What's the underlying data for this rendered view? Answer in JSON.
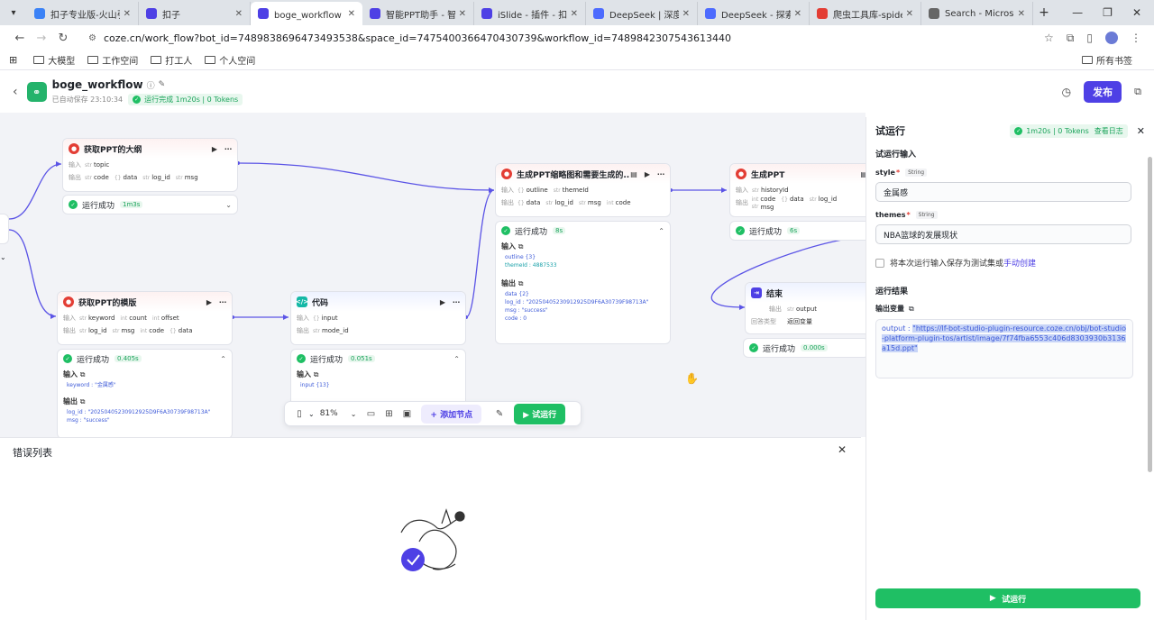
{
  "browser": {
    "tabs": [
      {
        "title": "扣子专业版-火山引擎",
        "color": "#3b82f6",
        "active": false
      },
      {
        "title": "扣子",
        "color": "#4e40e5",
        "active": false
      },
      {
        "title": "boge_workflow - 工",
        "color": "#4e40e5",
        "active": true
      },
      {
        "title": "智能PPT助手 - 智能",
        "color": "#4e40e5",
        "active": false
      },
      {
        "title": "iSlide - 插件 - 扣子",
        "color": "#4e40e5",
        "active": false
      },
      {
        "title": "DeepSeek | 深度求索",
        "color": "#4d6bfe",
        "active": false
      },
      {
        "title": "DeepSeek - 探索未至",
        "color": "#4d6bfe",
        "active": false
      },
      {
        "title": "爬虫工具库-spidert",
        "color": "#e33d34",
        "active": false
      },
      {
        "title": "Search - Microsoft",
        "color": "#666666",
        "active": false
      }
    ],
    "url": "coze.cn/work_flow?bot_id=7489838696473493538&space_id=7475400366470430739&workflow_id=7489842307543613440",
    "bookmarks": [
      "大模型",
      "工作空间",
      "打工人",
      "个人空间"
    ],
    "all_bookmarks": "所有书签"
  },
  "header": {
    "title": "boge_workflow",
    "autosave": "已自动保存 23:10:34",
    "run_status": "运行完成 1m20s | 0 Tokens",
    "publish": "发布"
  },
  "nodes": {
    "outline": {
      "title": "获取PPT的大纲",
      "input_label": "输入",
      "inputs": [
        {
          "type": "str",
          "name": "topic"
        }
      ],
      "output_label": "输出",
      "outputs": [
        {
          "type": "str",
          "name": "code"
        },
        {
          "type": "{}",
          "name": "data"
        },
        {
          "type": "str",
          "name": "log_id"
        },
        {
          "type": "str",
          "name": "msg"
        }
      ],
      "run": "运行成功",
      "time": "1m3s"
    },
    "template": {
      "title": "获取PPT的模版",
      "input_label": "输入",
      "inputs": [
        {
          "type": "str",
          "name": "keyword"
        },
        {
          "type": "int",
          "name": "count"
        },
        {
          "type": "int",
          "name": "offset"
        }
      ],
      "output_label": "输出",
      "outputs": [
        {
          "type": "str",
          "name": "log_id"
        },
        {
          "type": "str",
          "name": "msg"
        },
        {
          "type": "int",
          "name": "code"
        },
        {
          "type": "{}",
          "name": "data"
        }
      ],
      "run": "运行成功",
      "time": "0.405s",
      "in_sec": "输入",
      "in_lines": [
        "keyword : \"金属感\""
      ],
      "out_sec": "输出",
      "out_lines": [
        "log_id : \"20250405230912925D9F6A30739F98713A\"",
        "msg : \"success\""
      ]
    },
    "code": {
      "title": "代码",
      "input_label": "输入",
      "inputs": [
        {
          "type": "{}",
          "name": "input"
        }
      ],
      "output_label": "输出",
      "outputs": [
        {
          "type": "str",
          "name": "mode_id"
        }
      ],
      "run": "运行成功",
      "time": "0.051s",
      "in_sec": "输入",
      "in_lines": [
        "input {13}"
      ]
    },
    "thumb": {
      "title": "生成PPT缩略图和需要生成的...",
      "input_label": "输入",
      "inputs": [
        {
          "type": "{}",
          "name": "outline"
        },
        {
          "type": "str",
          "name": "themeId"
        }
      ],
      "output_label": "输出",
      "outputs": [
        {
          "type": "{}",
          "name": "data"
        },
        {
          "type": "str",
          "name": "log_id"
        },
        {
          "type": "str",
          "name": "msg"
        },
        {
          "type": "int",
          "name": "code"
        }
      ],
      "run": "运行成功",
      "time": "8s",
      "in_sec": "输入",
      "in_lines": [
        "outline {3}",
        "themeId : 4887533"
      ],
      "out_sec": "输出",
      "out_lines": [
        "data {2}",
        "log_id : \"20250405230912925D9F6A30739F98713A\"",
        "msg : \"success\"",
        "code : 0"
      ]
    },
    "gen": {
      "title": "生成PPT",
      "input_label": "输入",
      "inputs": [
        {
          "type": "str",
          "name": "historyId"
        }
      ],
      "output_label": "输出",
      "outputs": [
        {
          "type": "int",
          "name": "code"
        },
        {
          "type": "{}",
          "name": "data"
        },
        {
          "type": "str",
          "name": "log_id"
        },
        {
          "type": "str",
          "name": "msg"
        }
      ],
      "run": "运行成功",
      "time": "6s"
    },
    "end": {
      "title": "结束",
      "output_label": "输出",
      "outputs": [
        {
          "type": "str",
          "name": "output"
        }
      ],
      "mode_label": "回答类型",
      "mode_value": "返回变量",
      "run": "运行成功",
      "time": "0.000s"
    }
  },
  "toolbar": {
    "zoom": "81%",
    "add_node": "+ 添加节点",
    "test_run": "试运行"
  },
  "error_panel": {
    "title": "错误列表"
  },
  "right_panel": {
    "title": "试运行",
    "status": "1m20s | 0 Tokens",
    "view_log": "查看日志",
    "input_section": "试运行输入",
    "fields": [
      {
        "name": "style",
        "type": "String",
        "value": "金属感"
      },
      {
        "name": "themes",
        "type": "String",
        "value": "NBA篮球的发展现状"
      }
    ],
    "save_label": "将本次运行输入保存为测试集或",
    "save_link": "手动创建",
    "result_section": "运行结果",
    "output_var": "输出变量",
    "output_key": "output : ",
    "output_value": "\"https://lf-bot-studio-plugin-resource.coze.cn/obj/bot-studio-platform-plugin-tos/artist/image/7f74fba6553c406d8303930b3136a15d.ppt\"",
    "run_button": "试运行"
  }
}
